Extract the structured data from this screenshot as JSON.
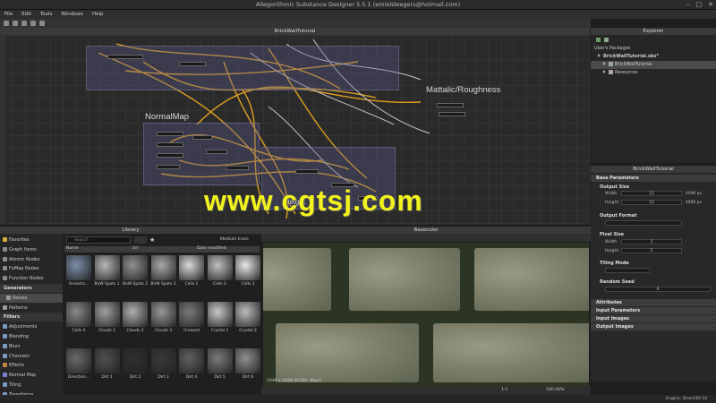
{
  "window": {
    "title": "Allegorithmic Substance Designer 5.5.1 (emielsleegers@hotmail.com)",
    "min": "–",
    "max": "□",
    "close": "✕"
  },
  "menu": [
    "File",
    "Edit",
    "Tools",
    "Windows",
    "Help"
  ],
  "graph": {
    "title": "BrickWallTutorial",
    "frames": {
      "normal": "NormalMap",
      "metal": "Mattalic/Roughness",
      "height": "Height"
    }
  },
  "explorer": {
    "title": "Explorer",
    "items": [
      "User's Packages",
      "BrickWallTutorial.sbs*",
      "BrickWallTutorial",
      "Resources"
    ]
  },
  "params": {
    "title": "BrickWallTutorial",
    "base_section": "Base Parameters",
    "output_size": {
      "label": "Output Size",
      "width_label": "Width",
      "height_label": "Height",
      "width_val": "12",
      "height_val": "12",
      "width_px": "4096 px",
      "height_px": "4096 px"
    },
    "output_format": {
      "label": "Output Format"
    },
    "pixel_size": {
      "label": "Pixel Size",
      "width_label": "Width",
      "height_label": "Height",
      "width_val": "1",
      "height_val": "1"
    },
    "tiling_mode": {
      "label": "Tiling Mode"
    },
    "random_seed": {
      "label": "Random Seed",
      "value": "0"
    },
    "sections": [
      "Attributes",
      "Input Parameters",
      "Input Images",
      "Output Images"
    ]
  },
  "library": {
    "title": "Library",
    "search_placeholder": "Search",
    "view_mode": "Medium Icons",
    "columns": [
      "Name",
      "Url",
      "Date modified"
    ],
    "categories": [
      {
        "label": "Favorites",
        "type": "item",
        "color": "#d8b040"
      },
      {
        "label": "Graph Items",
        "type": "item",
        "color": "#8a8a8a"
      },
      {
        "label": "Atomic Nodes",
        "type": "item",
        "color": "#8a8a8a"
      },
      {
        "label": "FxMap Nodes",
        "type": "item",
        "color": "#8a8a8a"
      },
      {
        "label": "Function Nodes",
        "type": "item",
        "color": "#8a8a8a"
      },
      {
        "label": "Generators",
        "type": "hdr",
        "color": "#8a8a8a"
      },
      {
        "label": "Noises",
        "type": "sel",
        "color": "#9a9a9a"
      },
      {
        "label": "Patterns",
        "type": "sub",
        "color": "#9a9a9a"
      },
      {
        "label": "Filters",
        "type": "hdr",
        "color": "#8a8a8a"
      },
      {
        "label": "Adjustments",
        "type": "sub",
        "color": "#7a9ac0"
      },
      {
        "label": "Blending",
        "type": "sub",
        "color": "#7a9ac0"
      },
      {
        "label": "Blurs",
        "type": "sub",
        "color": "#7a9ac0"
      },
      {
        "label": "Channels",
        "type": "sub",
        "color": "#7a9ac0"
      },
      {
        "label": "Effects",
        "type": "sub",
        "color": "#c08a40"
      },
      {
        "label": "Normal Map",
        "type": "sub",
        "color": "#8080d0"
      },
      {
        "label": "Tiling",
        "type": "sub",
        "color": "#7a9ac0"
      },
      {
        "label": "Transforms",
        "type": "sub",
        "color": "#7a9ac0"
      }
    ],
    "thumbs_row1": [
      "Anisotro...",
      "BnW Spots 1",
      "BnW Spots 2",
      "BnW Spots 3",
      "Cells 1",
      "Cells 2",
      "Cells 3"
    ],
    "thumbs_row2": [
      "Cells 4",
      "Clouds 1",
      "Clouds 2",
      "Clouds 3",
      "Creased",
      "Crystal 1",
      "Crystal 2"
    ],
    "thumbs_row3": [
      "Direction...",
      "Dirt 1",
      "Dirt 2",
      "Dirt 3",
      "Dirt 4",
      "Dirt 5",
      "Dirt 6"
    ]
  },
  "viewport": {
    "title": "Basecolor",
    "info": "2048 x 2048 (RGBA, 8bpc)",
    "zoom": "100.00%",
    "ratio": "1:1"
  },
  "status": {
    "engine": "Engine: Direct3D 10"
  },
  "watermark": "www.cgtsj.com"
}
